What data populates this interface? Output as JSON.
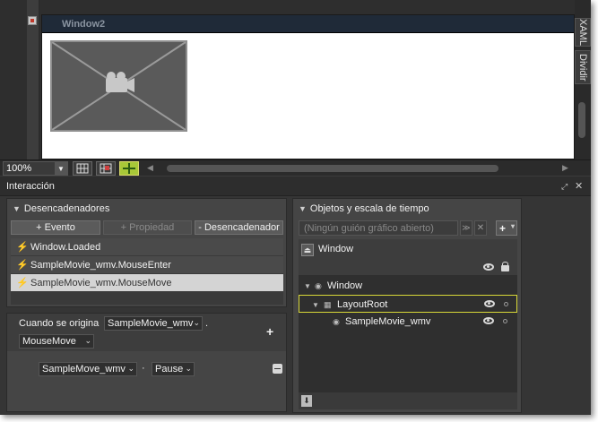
{
  "artboard": {
    "window_title": "Window2",
    "side_tabs": [
      "XAML",
      "Dividir"
    ]
  },
  "zoombar": {
    "zoom_value": "100%"
  },
  "interaction_panel": {
    "title": "Interacción"
  },
  "triggers": {
    "title": "Desencadenadores",
    "buttons": {
      "add_event": "+ Evento",
      "add_property": "+ Propiedad",
      "remove_trigger": "- Desencadenador"
    },
    "items": [
      {
        "label": "Window.Loaded",
        "selected": false
      },
      {
        "label": "SampleMovie_wmv.MouseEnter",
        "selected": false
      },
      {
        "label": "SampleMovie_wmv.MouseMove",
        "selected": true
      }
    ]
  },
  "condition": {
    "label": "Cuando se origina",
    "source": "SampleMovie_wmv",
    "separator": ".",
    "event": "MouseMove",
    "add_symbol": "+",
    "action_target": "SampleMove_wmv",
    "action_separator": "·",
    "action": "Pause"
  },
  "objects": {
    "title": "Objetos y escala de tiempo",
    "storyboard_placeholder": "(Ningún guión gráfico abierto)",
    "scope_title": "Window",
    "tree": [
      {
        "label": "Window",
        "level": 0
      },
      {
        "label": "LayoutRoot",
        "level": 1,
        "selected": true
      },
      {
        "label": "SampleMovie_wmv",
        "level": 2
      }
    ]
  }
}
